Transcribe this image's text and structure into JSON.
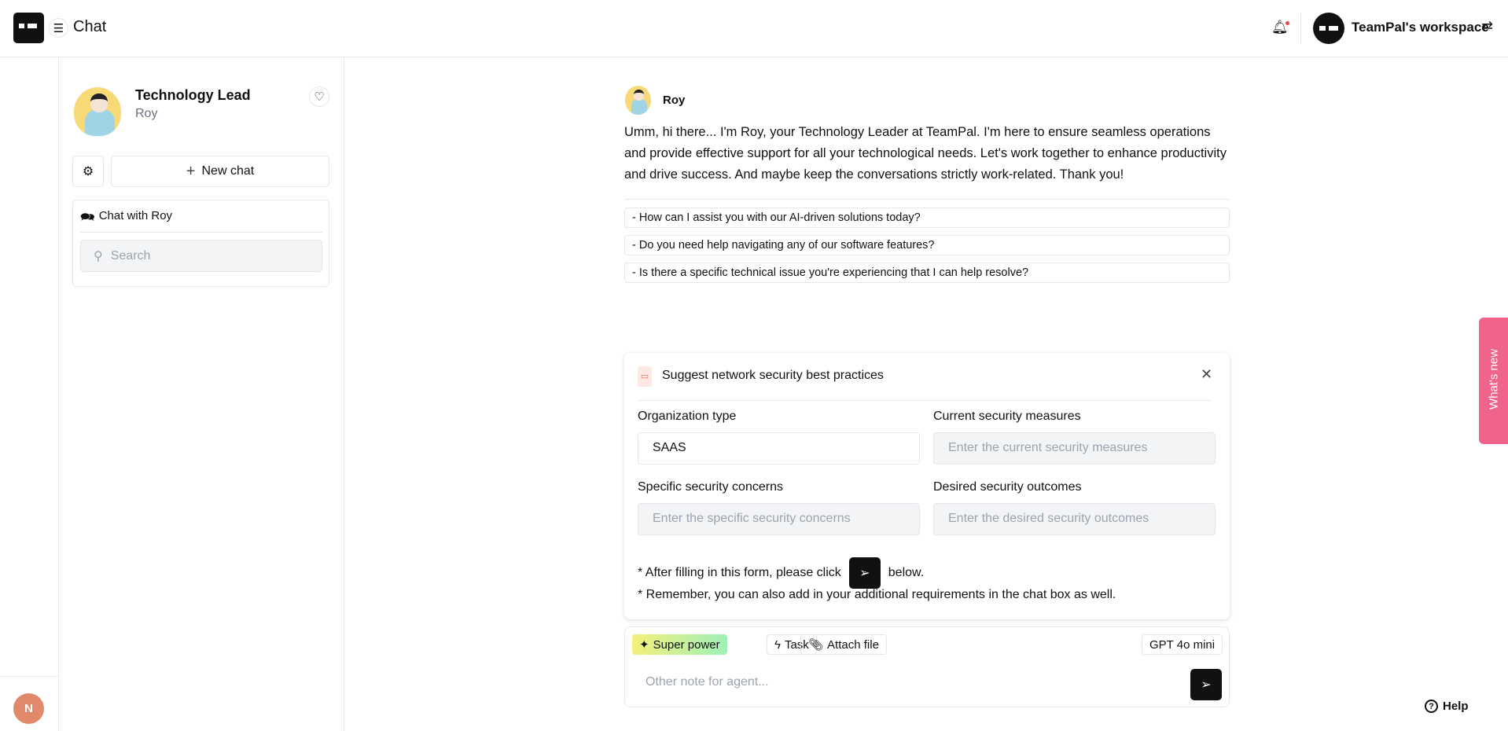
{
  "header": {
    "title": "Chat",
    "workspace": "TeamPal's workspace"
  },
  "rail": {
    "user_initial": "N"
  },
  "sidebar": {
    "agent_title": "Technology Lead",
    "agent_name": "Roy",
    "new_chat": "New chat",
    "chat_list_title": "Chat with Roy",
    "search_placeholder": "Search"
  },
  "message": {
    "sender": "Roy",
    "text": "Umm, hi there... I'm Roy, your Technology Leader at TeamPal. I'm here to ensure seamless operations and provide effective support for all your technological needs. Let's work together to enhance productivity and drive success. And maybe keep the conversations strictly work-related. Thank you!",
    "suggestions": [
      "- How can I assist you with our AI-driven solutions today?",
      "- Do you need help navigating any of our software features?",
      "- Is there a specific technical issue you're experiencing that I can help resolve?"
    ]
  },
  "form": {
    "title": "Suggest network security best practices",
    "fields": [
      {
        "label": "Organization type",
        "value": "SAAS",
        "placeholder": ""
      },
      {
        "label": "Current security measures",
        "value": "",
        "placeholder": "Enter the current security measures"
      },
      {
        "label": "Specific security concerns",
        "value": "",
        "placeholder": "Enter the specific security concerns"
      },
      {
        "label": "Desired security outcomes",
        "value": "",
        "placeholder": "Enter the desired security outcomes"
      }
    ],
    "note1_before": "* After filling in this form, please click",
    "note1_after": "below.",
    "note2": "* Remember, you can also add in your additional requirements in the chat box as well."
  },
  "composer": {
    "super_power": "Super power",
    "task": "Task",
    "attach": "Attach file",
    "model": "GPT 4o mini",
    "placeholder": "Other note for agent..."
  },
  "whats_new": "What's new",
  "help": "Help",
  "colors": {
    "accent_dark": "#111111",
    "whats_new": "#f0648c",
    "avatar_n": "#e0896b"
  }
}
